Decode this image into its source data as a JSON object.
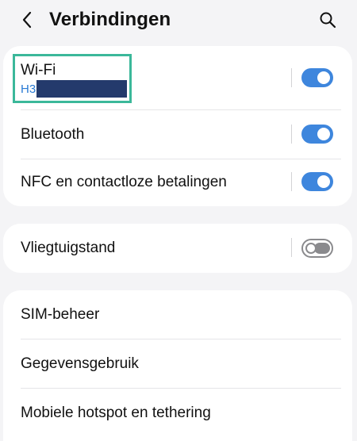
{
  "header": {
    "title": "Verbindingen",
    "back_icon": "chevron-left-icon",
    "search_icon": "search-icon"
  },
  "groups": [
    {
      "items": [
        {
          "label": "Wi-Fi",
          "subtitle": "H3",
          "toggle": "on"
        },
        {
          "label": "Bluetooth",
          "toggle": "on"
        },
        {
          "label": "NFC en contactloze betalingen",
          "toggle": "on"
        }
      ]
    },
    {
      "items": [
        {
          "label": "Vliegtuigstand",
          "toggle": "off"
        }
      ]
    },
    {
      "items": [
        {
          "label": "SIM-beheer"
        },
        {
          "label": "Gegevensgebruik"
        },
        {
          "label": "Mobiele hotspot en tethering"
        }
      ]
    }
  ],
  "colors": {
    "accent": "#3e86dd",
    "subtitle": "#2a7bd4",
    "highlight": "#3bb89a",
    "redaction": "#243a6c",
    "background": "#f4f4f6"
  }
}
